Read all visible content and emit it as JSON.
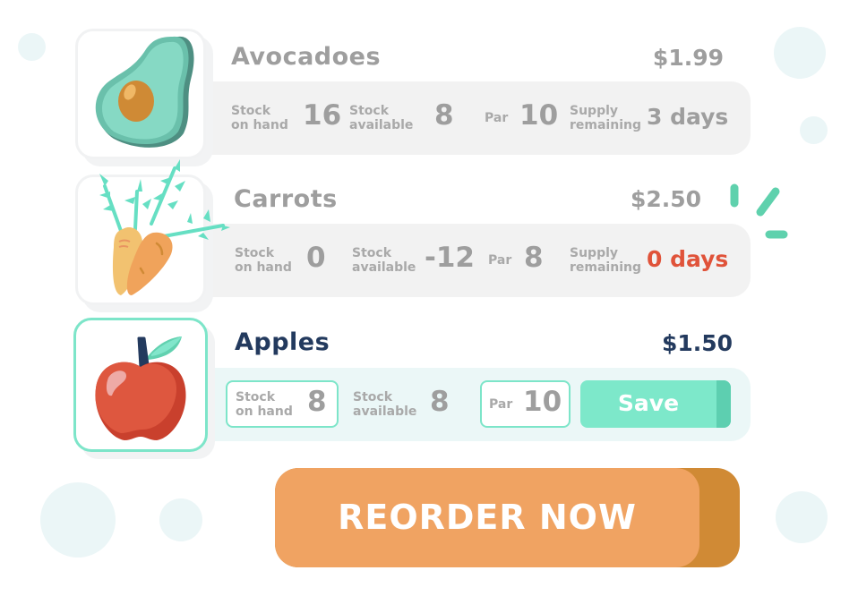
{
  "colors": {
    "accent_mint": "#7de5c9",
    "accent_orange": "#f0a362",
    "alert_red": "#e0533a",
    "navy": "#233a5e",
    "muted_gray": "#9e9e9e"
  },
  "products": [
    {
      "name": "Avocadoes",
      "price": "$1.99",
      "icon": "avocado-icon",
      "stock_on_hand_label_1": "Stock",
      "stock_on_hand_label_2": "on hand",
      "stock_on_hand": "16",
      "stock_available_label_1": "Stock",
      "stock_available_label_2": "available",
      "stock_available": "8",
      "par_label": "Par",
      "par": "10",
      "supply_label_1": "Supply",
      "supply_label_2": "remaining",
      "supply_remaining": "3 days"
    },
    {
      "name": "Carrots",
      "price": "$2.50",
      "icon": "carrot-icon",
      "stock_on_hand_label_1": "Stock",
      "stock_on_hand_label_2": "on hand",
      "stock_on_hand": "0",
      "stock_available_label_1": "Stock",
      "stock_available_label_2": "available",
      "stock_available": "-12",
      "par_label": "Par",
      "par": "8",
      "supply_label_1": "Supply",
      "supply_label_2": "remaining",
      "supply_remaining": "0 days"
    },
    {
      "name": "Apples",
      "price": "$1.50",
      "icon": "apple-icon",
      "stock_on_hand_label_1": "Stock",
      "stock_on_hand_label_2": "on hand",
      "stock_on_hand": "8",
      "stock_available_label_1": "Stock",
      "stock_available_label_2": "available",
      "stock_available": "8",
      "par_label": "Par",
      "par": "10",
      "save_label": "Save"
    }
  ],
  "reorder_label": "REORDER NOW"
}
